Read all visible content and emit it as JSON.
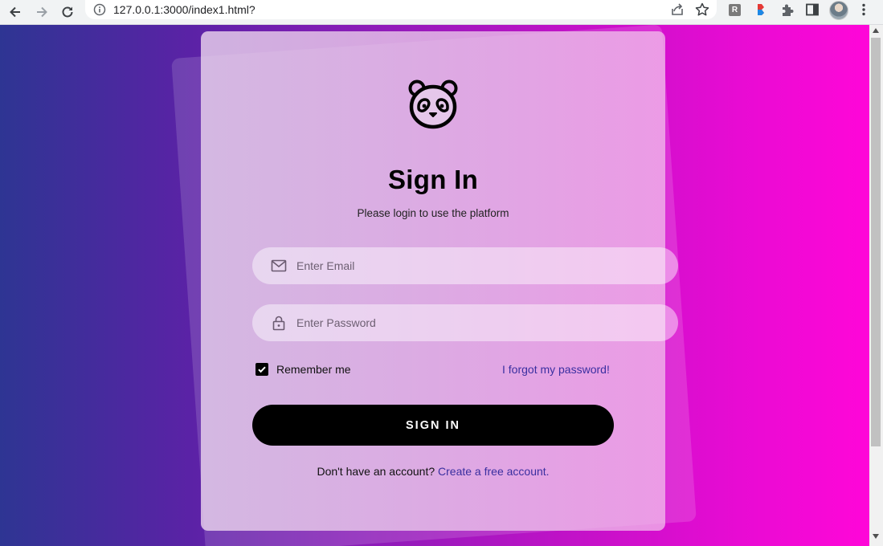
{
  "browser": {
    "url": "127.0.0.1:3000/index1.html?",
    "extension_label": "R"
  },
  "login": {
    "title": "Sign In",
    "subtitle": "Please login to use the platform",
    "email_placeholder": "Enter Email",
    "password_placeholder": "Enter Password",
    "remember_label": "Remember me",
    "remember_checked": true,
    "forgot_link": "I forgot my password!",
    "signin_button": "SIGN IN",
    "no_account_text": "Don't have an account?",
    "create_account_link": "Create a free account."
  },
  "icons": {
    "logo": "panda-icon",
    "email": "envelope-icon",
    "password": "lock-icon"
  },
  "colors": {
    "gradient_start": "#2e3593",
    "gradient_end": "#ff06d8",
    "button": "#000000",
    "link": "#3a2fa0"
  }
}
